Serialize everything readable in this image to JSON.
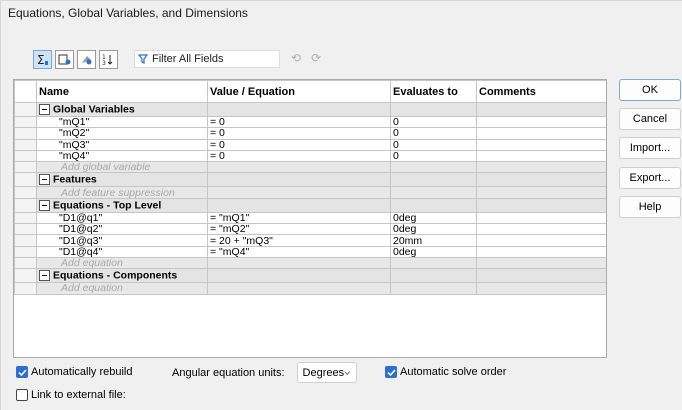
{
  "window": {
    "title": "Equations, Global Variables, and Dimensions"
  },
  "toolbar": {
    "filter_label": "Filter All Fields",
    "icons": [
      "equation-view-icon",
      "sketch-view-icon",
      "dimension-view-icon",
      "sort-order-icon",
      "filter-icon",
      "undo-icon",
      "redo-icon"
    ]
  },
  "table": {
    "headers": {
      "name": "Name",
      "value": "Value / Equation",
      "evaluates": "Evaluates to",
      "comments": "Comments"
    },
    "sections": [
      {
        "title": "Global Variables",
        "rows": [
          {
            "name": "\"mQ1\"",
            "value": "= 0",
            "evaluates": "0",
            "comments": ""
          },
          {
            "name": "\"mQ2\"",
            "value": "= 0",
            "evaluates": "0",
            "comments": ""
          },
          {
            "name": "\"mQ3\"",
            "value": "= 0",
            "evaluates": "0",
            "comments": ""
          },
          {
            "name": "\"mQ4\"",
            "value": "= 0",
            "evaluates": "0",
            "comments": ""
          }
        ],
        "placeholder": "Add global variable"
      },
      {
        "title": "Features",
        "rows": [],
        "placeholder": "Add feature suppression"
      },
      {
        "title": "Equations - Top Level",
        "rows": [
          {
            "name": "\"D1@q1\"",
            "value": "= \"mQ1\"",
            "evaluates": "0deg",
            "comments": ""
          },
          {
            "name": "\"D1@q2\"",
            "value": "= \"mQ2\"",
            "evaluates": "0deg",
            "comments": ""
          },
          {
            "name": "\"D1@q3\"",
            "value": "= 20 + \"mQ3\"",
            "evaluates": "20mm",
            "comments": ""
          },
          {
            "name": "\"D1@q4\"",
            "value": "= \"mQ4\"",
            "evaluates": "0deg",
            "comments": ""
          }
        ],
        "placeholder": "Add equation"
      },
      {
        "title": "Equations - Components",
        "rows": [],
        "placeholder": "Add equation"
      }
    ]
  },
  "buttons": {
    "ok": "OK",
    "cancel": "Cancel",
    "import": "Import...",
    "export": "Export...",
    "help": "Help"
  },
  "options": {
    "auto_rebuild": {
      "label": "Automatically rebuild",
      "checked": true
    },
    "angular_units_label": "Angular equation units:",
    "angular_units_value": "Degrees",
    "auto_solve": {
      "label": "Automatic solve order",
      "checked": true
    },
    "link_external": {
      "label": "Link to external file:",
      "checked": false
    }
  },
  "colors": {
    "accent": "#2b6fd1",
    "section_bg": "#e4e4e4",
    "placeholder_text": "#a8a8a8"
  }
}
